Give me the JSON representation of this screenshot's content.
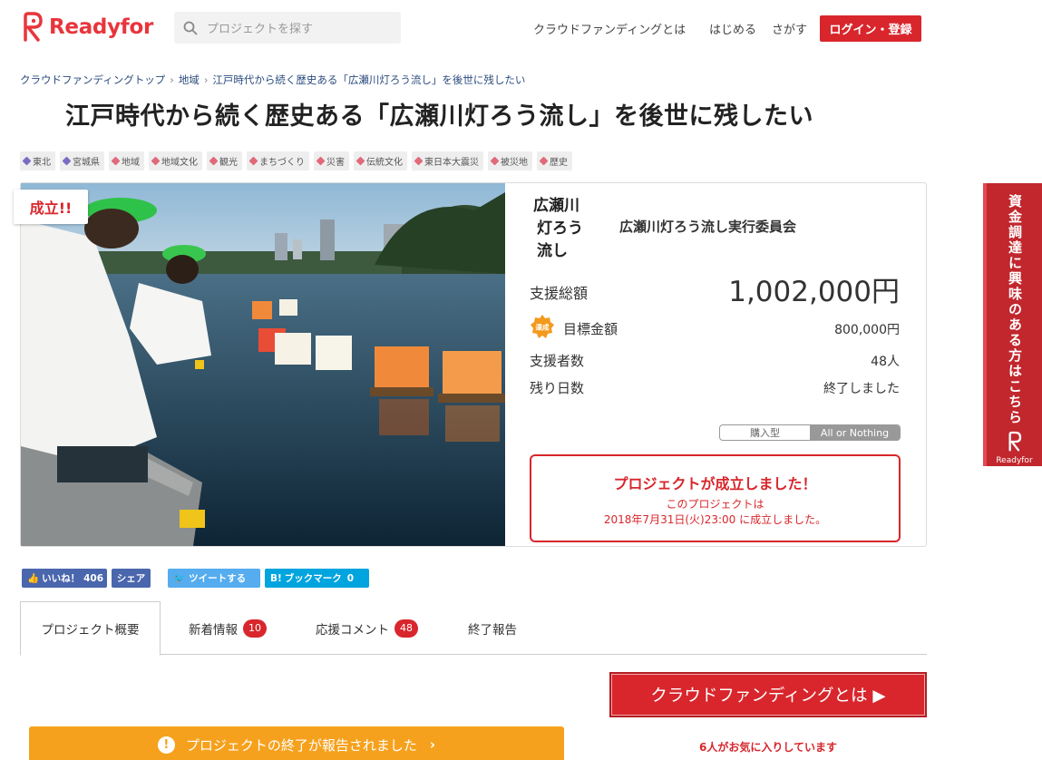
{
  "header": {
    "logo_text": "Readyfor",
    "search_placeholder": "プロジェクトを探す",
    "nav": [
      "クラウドファンディングとは",
      "はじめる",
      "さがす"
    ],
    "login_label": "ログイン・登録"
  },
  "breadcrumb": [
    "クラウドファンディングトップ",
    "地域",
    "江戸時代から続く歴史ある「広瀬川灯ろう流し」を後世に残したい"
  ],
  "title": "江戸時代から続く歴史ある「広瀬川灯ろう流し」を後世に残したい",
  "tags": [
    {
      "label": "東北",
      "color": "#7a6cc4"
    },
    {
      "label": "宮城県",
      "color": "#7a6cc4"
    },
    {
      "label": "地域",
      "color": "#e06a7a"
    },
    {
      "label": "地域文化",
      "color": "#e06a7a"
    },
    {
      "label": "観光",
      "color": "#e06a7a"
    },
    {
      "label": "まちづくり",
      "color": "#e06a7a"
    },
    {
      "label": "災害",
      "color": "#e06a7a"
    },
    {
      "label": "伝統文化",
      "color": "#e06a7a"
    },
    {
      "label": "東日本大震災",
      "color": "#e06a7a"
    },
    {
      "label": "被災地",
      "color": "#e06a7a"
    },
    {
      "label": "歴史",
      "color": "#e06a7a"
    }
  ],
  "project": {
    "status_badge": "成立!!",
    "org_logo_lines": [
      "広瀬川",
      "灯ろう",
      "流し"
    ],
    "org_name": "広瀬川灯ろう流し実行委員会",
    "total_label": "支援総額",
    "total_value": "1,002,000円",
    "achieved_badge": "達成",
    "goal_label": "目標金額",
    "goal_value": "800,000円",
    "supporters_label": "支援者数",
    "supporters_value": "48人",
    "remaining_label": "残り日数",
    "remaining_value": "終了しました",
    "type_options": [
      "購入型",
      "All or Nothing"
    ],
    "success_title": "プロジェクトが成立しました！",
    "success_line1": "このプロジェクトは",
    "success_line2": "2018年7月31日(火)23:00 に成立しました。"
  },
  "social": {
    "like_label": "いいね！",
    "like_count": "406",
    "share_label": "シェア",
    "tweet_label": "ツイートする",
    "bookmark_label": "ブックマーク",
    "bookmark_count": "0"
  },
  "tabs": [
    {
      "label": "プロジェクト概要",
      "count": null
    },
    {
      "label": "新着情報",
      "count": "10"
    },
    {
      "label": "応援コメント",
      "count": "48"
    },
    {
      "label": "終了報告",
      "count": null
    }
  ],
  "cta_button": "クラウドファンディングとは ▶",
  "favorites_text": "6人がお気に入りしています",
  "report_bar": "プロジェクトの終了が報告されました",
  "side_banner": {
    "text": "資金調達に興味のある方はこちら",
    "logo": "Readyfor"
  },
  "colors": {
    "brand_red": "#d8262c",
    "report_orange": "#f6a11d",
    "facebook": "#4a66ad",
    "twitter": "#55acee",
    "hatena": "#00a4de"
  }
}
